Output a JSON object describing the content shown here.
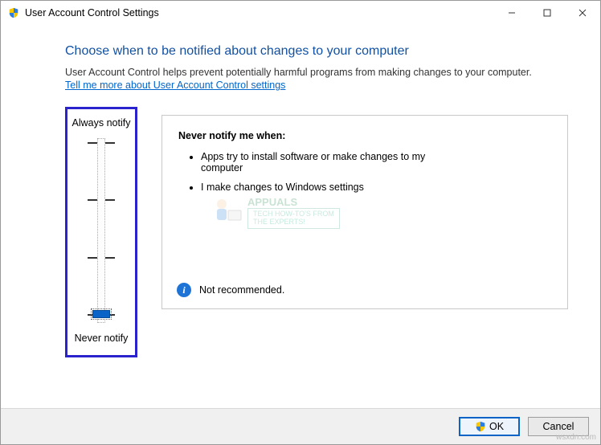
{
  "window": {
    "title": "User Account Control Settings"
  },
  "heading": "Choose when to be notified about changes to your computer",
  "description": "User Account Control helps prevent potentially harmful programs from making changes to your computer.",
  "learn_link": "Tell me more about User Account Control settings",
  "slider": {
    "top_label": "Always notify",
    "bottom_label": "Never notify",
    "levels": 4,
    "current_level": 0
  },
  "infobox": {
    "title": "Never notify me when:",
    "bullets": [
      "Apps try to install software or make changes to my computer",
      "I make changes to Windows settings"
    ],
    "recommendation": "Not recommended."
  },
  "buttons": {
    "ok": "OK",
    "cancel": "Cancel"
  },
  "watermark": {
    "brand": "APPUALS",
    "tagline1": "TECH HOW-TO'S FROM",
    "tagline2": "THE EXPERTS!",
    "site": "wsxdn.com"
  }
}
